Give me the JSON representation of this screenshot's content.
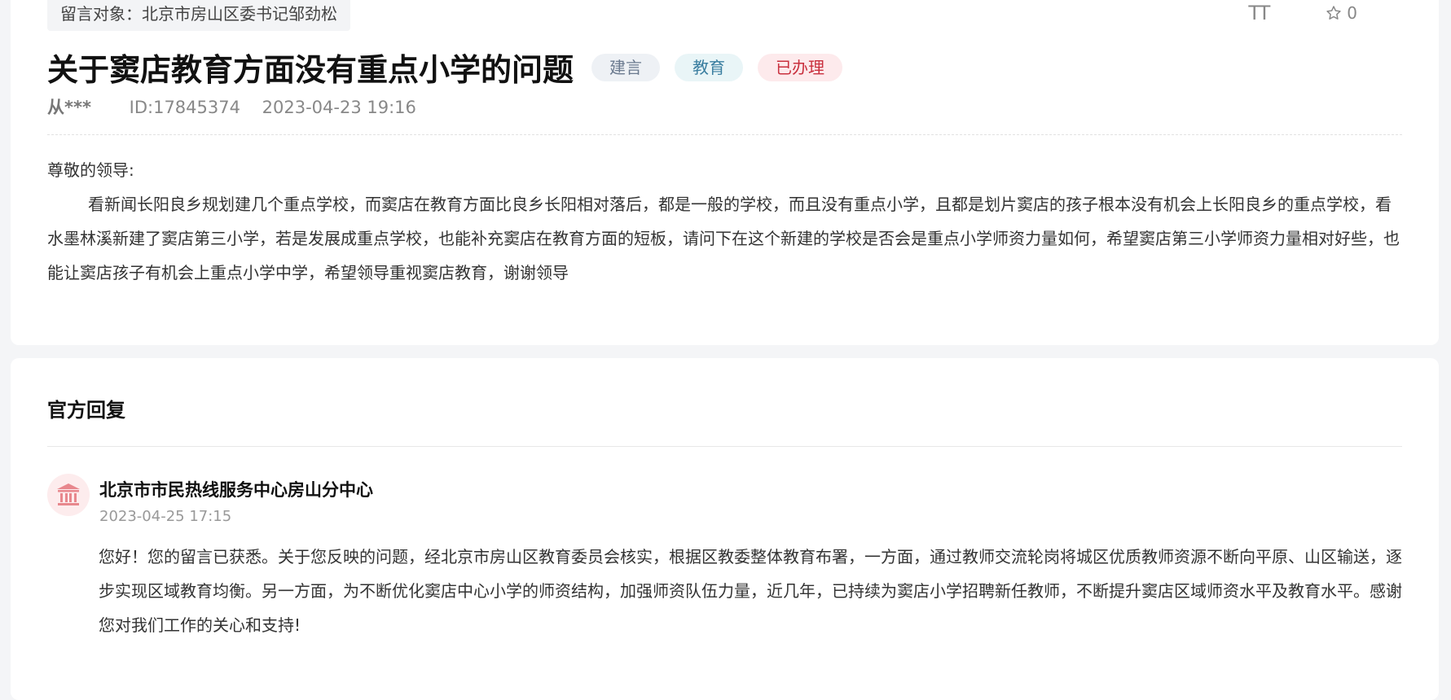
{
  "message": {
    "target_label": "留言对象：北京市房山区委书记邹劲松",
    "font_size_toggle": "TT",
    "favorite_count": "0",
    "title": "关于窦店教育方面没有重点小学的问题",
    "tags": [
      "建言",
      "教育",
      "已办理"
    ],
    "author": "从***",
    "id_text": "ID:17845374",
    "datetime": "2023-04-23 19:16",
    "salutation": "尊敬的领导:",
    "body": "看新闻长阳良乡规划建几个重点学校，而窦店在教育方面比良乡长阳相对落后，都是一般的学校，而且没有重点小学，且都是划片窦店的孩子根本没有机会上长阳良乡的重点学校，看水墨林溪新建了窦店第三小学，若是发展成重点学校，也能补充窦店在教育方面的短板，请问下在这个新建的学校是否会是重点小学师资力量如何，希望窦店第三小学师资力量相对好些，也能让窦店孩子有机会上重点小学中学，希望领导重视窦店教育，谢谢领导"
  },
  "official_reply": {
    "section_title": "官方回复",
    "department": "北京市市民热线服务中心房山分中心",
    "datetime": "2023-04-25 17:15",
    "content": "您好！您的留言已获悉。关于您反映的问题，经北京市房山区教育委员会核实，根据区教委整体教育布署，一方面，通过教师交流轮岗将城区优质教师资源不断向平原、山区输送，逐步实现区域教育均衡。另一方面，为不断优化窦店中心小学的师资结构，加强师资队伍力量，近几年，已持续为窦店小学招聘新任教师，不断提升窦店区域师资水平及教育水平。感谢您对我们工作的关心和支持!"
  },
  "colors": {
    "accent_red": "#c9303e",
    "avatar_icon": "#e8878d"
  }
}
